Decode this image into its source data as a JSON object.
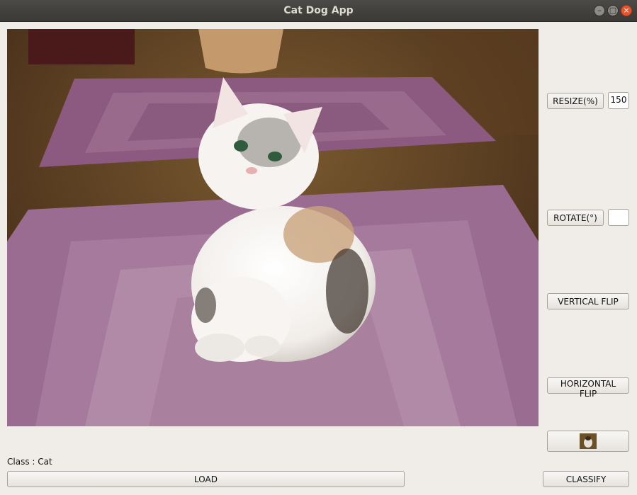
{
  "window": {
    "title": "Cat Dog App"
  },
  "controls": {
    "resize_label": "RESIZE(%)",
    "resize_value": "150",
    "rotate_label": "ROTATE(°)",
    "rotate_value": "",
    "vertical_flip_label": "VERTICAL FLIP",
    "horizontal_flip_label": "HORIZONTAL FLIP",
    "thumbnail_icon": "cat-thumbnail-icon"
  },
  "result": {
    "class_text": "Class : Cat"
  },
  "bottom": {
    "load_label": "LOAD",
    "classify_label": "CLASSIFY"
  }
}
